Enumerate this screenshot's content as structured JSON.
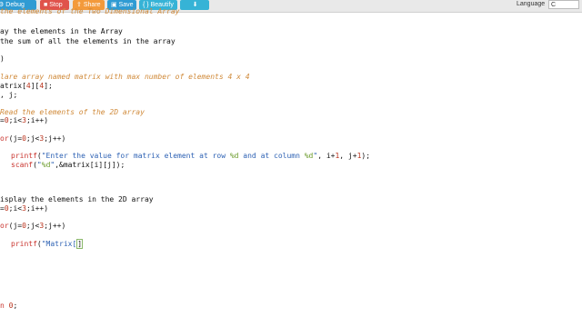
{
  "toolbar": {
    "debug": "Debug",
    "stop": "Stop",
    "share": "Share",
    "save": "Save",
    "beautify": "{ } Beautify",
    "language_label": "Language",
    "language_value": "C",
    "colors": {
      "debug": "#2f9bd3",
      "stop": "#e0534b",
      "share": "#f39a3b",
      "save": "#2f9bd3",
      "beautify": "#36b3d6",
      "download": "#36b3d6"
    }
  },
  "code": {
    "l1": "the elements of the Two Dimensional Array",
    "l2": "ay the elements in the Array",
    "l3": "the sum of all the elements in the array",
    "l4": ")",
    "l5": "lare array named matrix with max number of elements 4 x 4",
    "l6a": "atrix[",
    "l6b": "4",
    "l6c": "][",
    "l6d": "4",
    "l6e": "];",
    "l7": ", j;",
    "l8": "Read the elements of the 2D array",
    "l9a": "=",
    "l9b": "0",
    "l9c": ";i<",
    "l9d": "3",
    "l9e": ";i++)",
    "l10a": "or",
    "l10b": "(j=",
    "l10c": "0",
    "l10d": ";j<",
    "l10e": "3",
    "l10f": ";j++)",
    "l11a": "printf",
    "l11b": "(",
    "l11c": "\"Enter the value for matrix element at row ",
    "l11d": "%d",
    "l11e": " and at column ",
    "l11f": "%d",
    "l11g": "\"",
    "l11h": ", i+",
    "l11i": "1",
    "l11j": ", j+",
    "l11k": "1",
    "l11l": ");",
    "l12a": "scanf",
    "l12b": "(",
    "l12c": "\"",
    "l12d": "%d",
    "l12e": "\"",
    "l12f": ",&matrix[i][j]);",
    "l13": "isplay the elements in the 2D array",
    "l14a": "=",
    "l14b": "0",
    "l14c": ";i<",
    "l14d": "3",
    "l14e": ";i++)",
    "l15a": "or",
    "l15b": "(j=",
    "l15c": "0",
    "l15d": ";j<",
    "l15e": "3",
    "l15f": ";j++)",
    "l16a": "printf",
    "l16b": "(",
    "l16c": "\"Matrix[",
    "l16d": "]",
    "l17a": "n ",
    "l17b": "0",
    "l17c": ";"
  }
}
